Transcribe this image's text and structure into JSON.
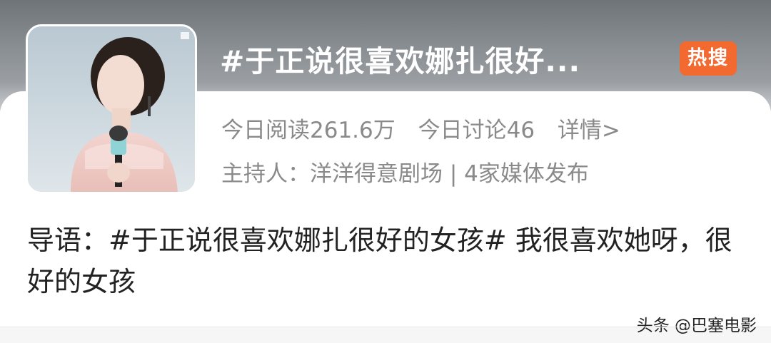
{
  "topic": {
    "title": "#于正说很喜欢娜扎很好...",
    "badge": "热搜",
    "badge_color": "#f26a2f"
  },
  "stats": {
    "reads": "今日阅读261.6万",
    "discussions": "今日讨论46",
    "details_link": "详情>"
  },
  "host": {
    "text": "主持人：洋洋得意剧场 | 4家媒体发布"
  },
  "intro": {
    "text": "导语：#于正说很喜欢娜扎很好的女孩# 我很喜欢她呀，很好的女孩"
  },
  "watermark": {
    "text": "头条 @巴塞电影"
  },
  "thumbnail": {
    "icon": "photo-of-woman-with-microphone"
  }
}
